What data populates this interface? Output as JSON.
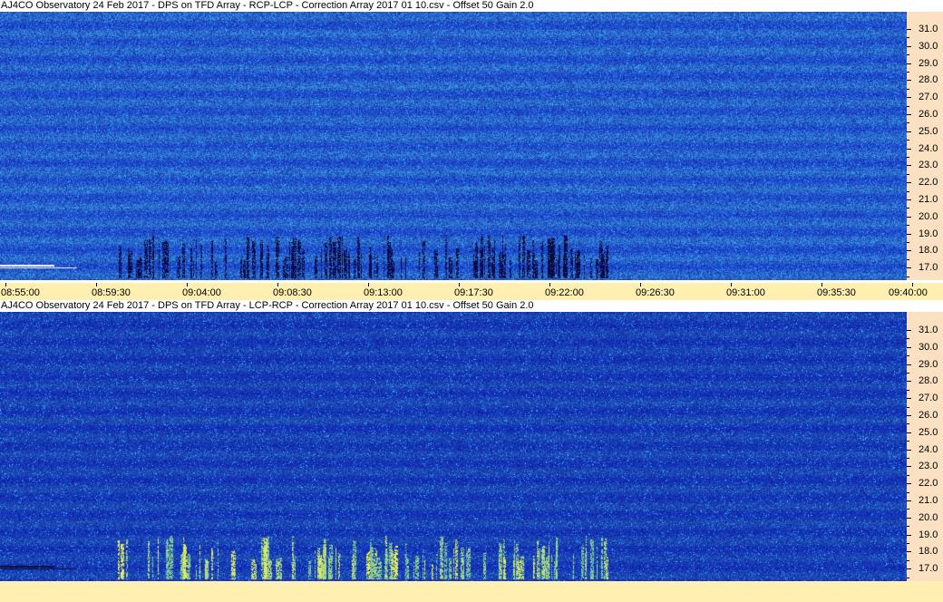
{
  "panels": [
    {
      "title": "AJ4CO Observatory 24 Feb 2017  -  DPS on TFD Array  -  RCP-LCP  -  Correction Array 2017 01 10.csv  -  Offset 50  Gain 2.0",
      "polarity": "RCP-LCP",
      "burst_style": "dark",
      "frequency_labels": [
        "31.0",
        "30.0",
        "29.0",
        "28.0",
        "27.0",
        "26.0",
        "25.0",
        "24.0",
        "23.0",
        "22.0",
        "21.0",
        "20.0",
        "19.0",
        "18.0",
        "17.0"
      ],
      "time_labels": [
        "08:55:00",
        "08:59:30",
        "09:04:00",
        "09:08:30",
        "09:13:00",
        "09:17:30",
        "09:22:00",
        "09:26:30",
        "09:31:00",
        "09:35:30",
        "09:40:00"
      ]
    },
    {
      "title": "AJ4CO Observatory 24 Feb 2017  -  DPS on TFD Array  -  LCP-RCP  -  Correction Array 2017 01 10.csv  -  Offset 50  Gain 2.0",
      "polarity": "LCP-RCP",
      "burst_style": "bright",
      "frequency_labels": [
        "31.0",
        "30.0",
        "29.0",
        "28.0",
        "27.0",
        "26.0",
        "25.0",
        "24.0",
        "23.0",
        "22.0",
        "21.0",
        "20.0",
        "19.0",
        "18.0",
        "17.0"
      ],
      "time_labels": []
    }
  ],
  "colors": {
    "background_rcp": "#2a6ae0",
    "background_lcp": "#1c48c8",
    "burst_dark": "#0a0a40",
    "burst_bright": "#d8f070",
    "freq_axis_bg": "#fbe0c2",
    "time_axis_bg": "#ffefb0"
  }
}
